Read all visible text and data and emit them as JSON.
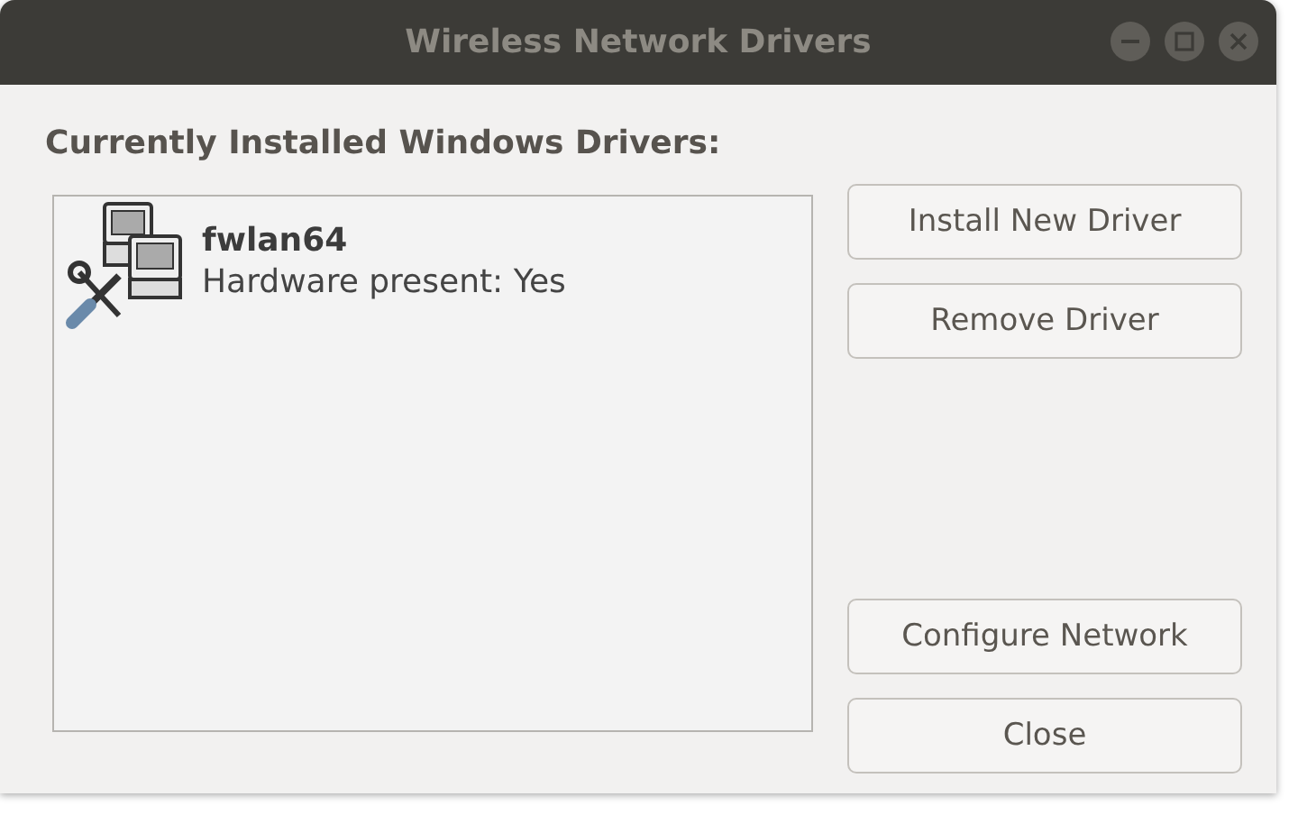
{
  "window": {
    "title": "Wireless Network Drivers"
  },
  "heading": "Currently Installed Windows Drivers:",
  "drivers": [
    {
      "name": "fwlan64",
      "status": "Hardware present: Yes"
    }
  ],
  "buttons_top": [
    "Install New Driver",
    "Remove Driver"
  ],
  "buttons_bottom": [
    "Configure Network",
    "Close"
  ]
}
